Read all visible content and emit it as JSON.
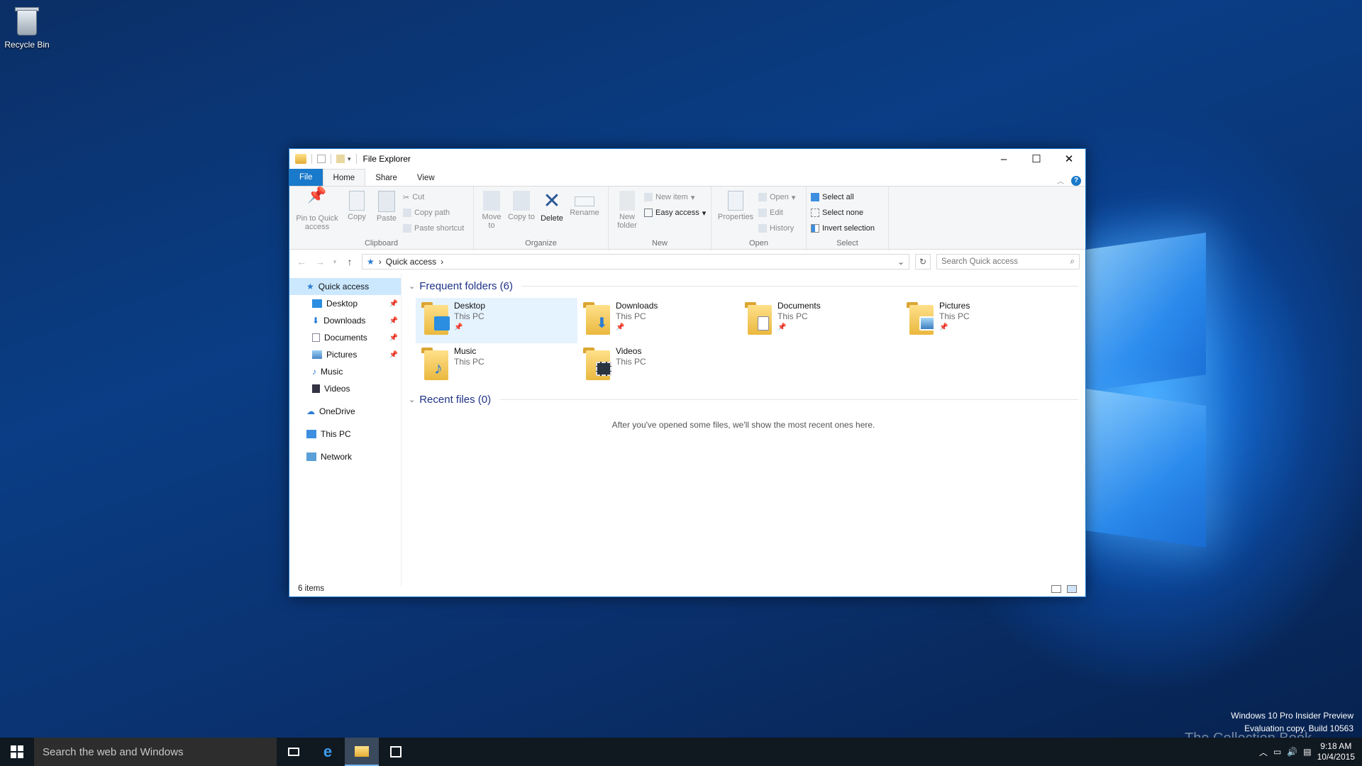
{
  "desktop": {
    "recycle_bin": "Recycle Bin"
  },
  "window": {
    "title": "File Explorer"
  },
  "tabs": [
    "File",
    "Home",
    "Share",
    "View"
  ],
  "ribbon": {
    "clipboard": {
      "name": "Clipboard",
      "pin": "Pin to Quick access",
      "copy": "Copy",
      "paste": "Paste",
      "cut": "Cut",
      "copy_path": "Copy path",
      "paste_shortcut": "Paste shortcut"
    },
    "organize": {
      "name": "Organize",
      "move_to": "Move to",
      "copy_to": "Copy to",
      "delete": "Delete",
      "rename": "Rename"
    },
    "new": {
      "name": "New",
      "new_folder": "New folder",
      "new_item": "New item",
      "easy_access": "Easy access"
    },
    "open": {
      "name": "Open",
      "properties": "Properties",
      "open": "Open",
      "edit": "Edit",
      "history": "History"
    },
    "select": {
      "name": "Select",
      "select_all": "Select all",
      "select_none": "Select none",
      "invert": "Invert selection"
    }
  },
  "address": {
    "path": "Quick access",
    "search_placeholder": "Search Quick access"
  },
  "nav": {
    "quick_access": "Quick access",
    "items": [
      "Desktop",
      "Downloads",
      "Documents",
      "Pictures",
      "Music",
      "Videos"
    ],
    "onedrive": "OneDrive",
    "thispc": "This PC",
    "network": "Network"
  },
  "content": {
    "frequent_title": "Frequent folders (6)",
    "folders": [
      {
        "name": "Desktop",
        "location": "This PC"
      },
      {
        "name": "Downloads",
        "location": "This PC"
      },
      {
        "name": "Documents",
        "location": "This PC"
      },
      {
        "name": "Pictures",
        "location": "This PC"
      },
      {
        "name": "Music",
        "location": "This PC"
      },
      {
        "name": "Videos",
        "location": "This PC"
      }
    ],
    "recent_title": "Recent files (0)",
    "recent_empty": "After you've opened some files, we'll show the most recent ones here."
  },
  "status": {
    "items": "6 items"
  },
  "taskbar": {
    "search": "Search the web and Windows",
    "time": "9:18 AM",
    "date": "10/4/2015"
  },
  "watermark": {
    "line1": "Windows 10 Pro Insider Preview",
    "line2": "Evaluation copy. Build 10563",
    "brand": "The Collection Book"
  }
}
